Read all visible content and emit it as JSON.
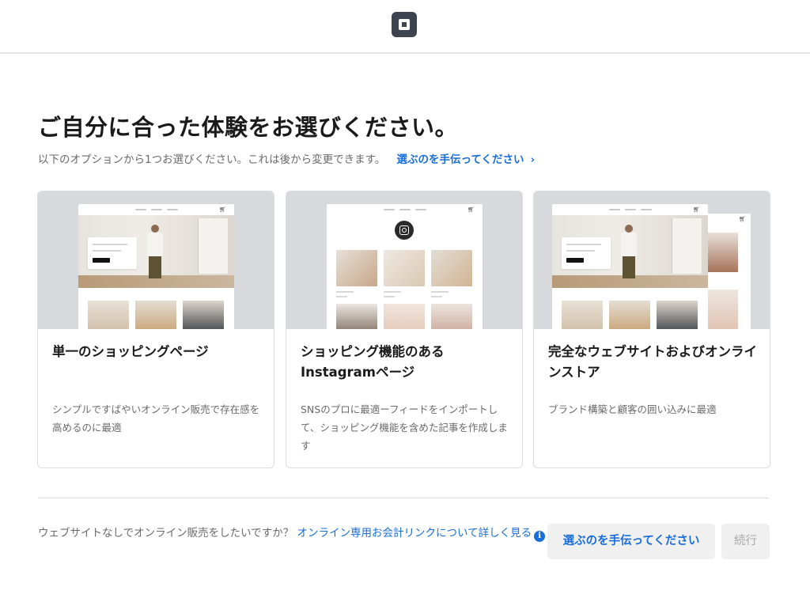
{
  "header": {
    "logo_icon": "square-logo-icon"
  },
  "page": {
    "title": "ご自分に合った体験をお選びください。",
    "subtitle": "以下のオプションから1つお選びください。これは後から変更できます。",
    "help_link": "選ぶのを手伝ってください",
    "help_link_icon": "chevron-right-icon"
  },
  "cards": [
    {
      "title": "単一のショッピングページ",
      "description": "シンプルですばやいオンライン販売で存在感を高めるのに最適"
    },
    {
      "title": "ショッピング機能のあるInstagramページ",
      "description": "SNSのプロに最適ーフィードをインポートして、ショッピング機能を含めた記事を作成します"
    },
    {
      "title": "完全なウェブサイトおよびオンラインストア",
      "description": "ブランド構築と顧客の囲い込みに最適"
    }
  ],
  "footer": {
    "question": "ウェブサイトなしでオンライン販売をしたいですか？",
    "link": "オンライン専用お会計リンクについて詳しく見る",
    "info_icon": "info-icon",
    "help_button": "選ぶのを手伝ってください",
    "continue_button": "続行"
  },
  "colors": {
    "accent": "#1a6ed8",
    "logo": "#3d4450",
    "card_media_bg": "#d7d9dc"
  }
}
